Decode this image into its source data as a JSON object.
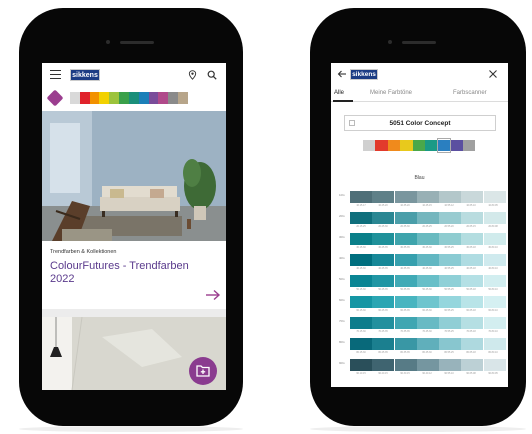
{
  "left_screen": {
    "logo_text": "sikkens",
    "swatch_colors": [
      "#d9d9d9",
      "#e0232b",
      "#f29100",
      "#f2d100",
      "#9cc33c",
      "#3aa04a",
      "#1a8f7a",
      "#1b7fb8",
      "#7a4c9a",
      "#b04a8a",
      "#8a8a8a",
      "#b7a58a"
    ],
    "card": {
      "kicker": "Trendfarben & Kollektionen",
      "title": "ColourFutures - Trendfarben 2022"
    },
    "icons": [
      "menu-icon",
      "location-pin-icon",
      "search-icon",
      "tag-icon",
      "arrow-right-icon",
      "folder-add-icon"
    ],
    "accent_color": "#8a3b8f"
  },
  "right_screen": {
    "logo_text": "sikkens",
    "tabs": [
      {
        "label": "Alle",
        "active": true
      },
      {
        "label": "Meine Farbtöne",
        "active": false
      },
      {
        "label": "Farbscanner",
        "active": false
      }
    ],
    "concept_title": "5051 Color Concept",
    "family_label": "Blau",
    "swatch_colors": [
      "#d0d0d0",
      "#e23a2c",
      "#f08a1c",
      "#e8c91c",
      "#4aa84a",
      "#1a9a86",
      "#2a7fc0",
      "#5b4fa0",
      "#a0a0a0"
    ],
    "selected_swatch": 6,
    "grid_rows": [
      {
        "label": "10G",
        "colors": [
          "#4f6f78",
          "#5f8088",
          "#7a969e",
          "#98b0b5",
          "#b3c7ca",
          "#c9d8da",
          "#dbe6e7"
        ],
        "codes": [
          "10.15.17",
          "10.25.20",
          "10.35.20",
          "10.45.15",
          "10.55.12",
          "10.65.10",
          "10.80.05"
        ]
      },
      {
        "label": "20G",
        "colors": [
          "#0f6f7c",
          "#2a8793",
          "#4a9ea9",
          "#74b6be",
          "#98cbd0",
          "#b9dcdf",
          "#d3e9ea"
        ],
        "codes": [
          "20.15.25",
          "20.25.30",
          "20.35.30",
          "20.45.25",
          "20.55.20",
          "20.65.15",
          "20.80.08"
        ]
      },
      {
        "label": "30G",
        "colors": [
          "#0a7f89",
          "#1f919a",
          "#3ea4ac",
          "#69bac0",
          "#8fccd0",
          "#b3dde0",
          "#d0ebec"
        ],
        "codes": [
          "30.15.30",
          "30.25.35",
          "30.35.35",
          "30.45.30",
          "30.55.25",
          "30.65.18",
          "30.80.10"
        ]
      },
      {
        "label": "40G",
        "colors": [
          "#006f7f",
          "#178898",
          "#36a0ae",
          "#62b7c2",
          "#8acbd3",
          "#afdce2",
          "#cfeaee"
        ],
        "codes": [
          "40.15.30",
          "40.25.35",
          "40.35.35",
          "40.45.30",
          "40.55.25",
          "40.65.18",
          "40.80.10"
        ]
      },
      {
        "label": "50G",
        "colors": [
          "#0a8594",
          "#2096a4",
          "#40aab6",
          "#68bfc8",
          "#8fd0d7",
          "#b4e0e5",
          "#d2eef0"
        ],
        "codes": [
          "50.15.30",
          "50.25.35",
          "50.35.35",
          "50.45.30",
          "50.55.25",
          "50.65.18",
          "50.80.10"
        ]
      },
      {
        "label": "60G",
        "colors": [
          "#1596a4",
          "#2aa6b3",
          "#48b5c0",
          "#6ec5ce",
          "#95d6dd",
          "#b8e4e8",
          "#d5f0f2"
        ],
        "codes": [
          "60.15.30",
          "60.25.35",
          "60.35.35",
          "60.45.30",
          "60.55.25",
          "60.65.18",
          "60.80.10"
        ]
      },
      {
        "label": "70G",
        "colors": [
          "#0d7d8c",
          "#22909e",
          "#40a6b2",
          "#68bac4",
          "#90ced5",
          "#b5dfe3",
          "#d3eef0"
        ],
        "codes": [
          "70.15.30",
          "70.25.35",
          "70.35.35",
          "70.45.30",
          "70.55.25",
          "70.65.18",
          "70.80.10"
        ]
      },
      {
        "label": "80G",
        "colors": [
          "#08697a",
          "#1b7f8f",
          "#3997a5",
          "#60afbb",
          "#88c6cf",
          "#aed9df",
          "#cfe9ec"
        ],
        "codes": [
          "80.15.30",
          "80.25.35",
          "80.35.35",
          "80.45.30",
          "80.55.25",
          "80.65.18",
          "80.80.10"
        ]
      },
      {
        "label": "90G",
        "colors": [
          "#2a4f5a",
          "#3f6470",
          "#577b86",
          "#7596a0",
          "#98b3bb",
          "#bcd0d5",
          "#d9e5e8"
        ],
        "codes": [
          "90.10.15",
          "90.20.15",
          "90.30.15",
          "90.40.12",
          "90.55.10",
          "90.65.08",
          "90.80.05"
        ]
      }
    ],
    "icons": [
      "back-arrow-icon",
      "close-icon"
    ]
  }
}
